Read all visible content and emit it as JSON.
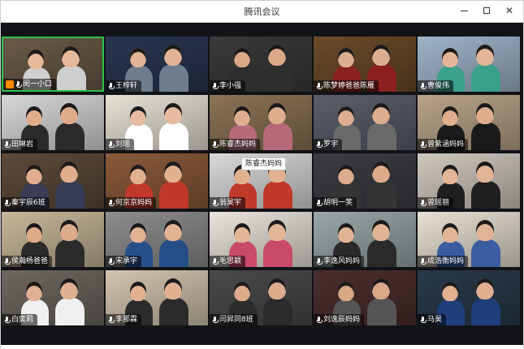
{
  "window": {
    "title": "腾讯会议",
    "controls": {
      "minimize_icon": "minimize-icon",
      "maximize_icon": "maximize-icon",
      "close_icon": "close-icon",
      "close_glyph": "✕"
    }
  },
  "tooltip": "陈睿杰妈妈",
  "participants": [
    {
      "name": "闵一小口",
      "host": true,
      "bg": "#6a5a48",
      "skin": "#e6b99a",
      "shirt": "#cfcfcf"
    },
    {
      "name": "王梓轩",
      "bg": "#2a3550",
      "skin": "#e2b394",
      "shirt": "#6f7d8e"
    },
    {
      "name": "李小强",
      "bg": "#3a3a3a",
      "skin": "#dba98a",
      "shirt": "#2e2e2e"
    },
    {
      "name": "陈梦婷爸爸陈雁",
      "bg": "#6a4a2a",
      "skin": "#dcae90",
      "shirt": "#8a2020"
    },
    {
      "name": "曹俊伟",
      "bg": "#9fb4c8",
      "skin": "#e2b596",
      "shirt": "#3aa08a"
    },
    {
      "name": "田琳岩",
      "bg": "#d8d8d8",
      "skin": "#e0ad8c",
      "shirt": "#2a2a2a"
    },
    {
      "name": "刘瑶",
      "bg": "#e7e2d6",
      "skin": "#e6bba0",
      "shirt": "#ffffff"
    },
    {
      "name": "陈睿杰妈妈",
      "bg": "#8b7355",
      "skin": "#deae8e",
      "shirt": "#b76a7a"
    },
    {
      "name": "罗宇",
      "bg": "#5a5f6a",
      "skin": "#dcae8f",
      "shirt": "#6a6a6a"
    },
    {
      "name": "曾紫涵妈妈",
      "bg": "#b9a48a",
      "skin": "#dfae8e",
      "shirt": "#1a1a1a"
    },
    {
      "name": "秦宇辰6班",
      "bg": "#5c4a3a",
      "skin": "#e0ae8f",
      "shirt": "#383c55"
    },
    {
      "name": "何京京妈妈",
      "bg": "#8a5a3a",
      "skin": "#e2b190",
      "shirt": "#c0392b"
    },
    {
      "name": "翁昊宇",
      "bg": "#d9d9d9",
      "skin": "#e1b292",
      "shirt": "#c0392b"
    },
    {
      "name": "胡明一笑",
      "bg": "#3b3d42",
      "skin": "#dcab8c",
      "shirt": "#353535"
    },
    {
      "name": "曾瑶丽",
      "bg": "#cfc8bf",
      "skin": "#e2b596",
      "shirt": "#1f1f1f"
    },
    {
      "name": "侯瀚杨爸爸",
      "bg": "#c7b79a",
      "skin": "#dcab8a",
      "shirt": "#2b2b2b"
    },
    {
      "name": "宋承宇",
      "bg": "#8d8d8d",
      "skin": "#e2b393",
      "shirt": "#264f8a"
    },
    {
      "name": "毛思颖",
      "bg": "#e9e4dc",
      "skin": "#e3b698",
      "shirt": "#c94a6a"
    },
    {
      "name": "李逸风妈妈",
      "bg": "#9aa6a6",
      "skin": "#e1b394",
      "shirt": "#2a2a2a"
    },
    {
      "name": "成浩衡妈妈",
      "bg": "#e7e0d4",
      "skin": "#e2b596",
      "shirt": "#3b5ca0"
    },
    {
      "name": "白奕莉",
      "bg": "#6d6760",
      "skin": "#dfb091",
      "shirt": "#efefef"
    },
    {
      "name": "李那霖",
      "bg": "#d3c5b0",
      "skin": "#e1b191",
      "shirt": "#2b2b2b"
    },
    {
      "name": "闫昇同8班",
      "bg": "#4a4a4a",
      "skin": "#dcab8c",
      "shirt": "#2b2b2b"
    },
    {
      "name": "刘逸辰妈妈",
      "bg": "#4b2e2e",
      "skin": "#d9a889",
      "shirt": "#555555"
    },
    {
      "name": "马昊",
      "bg": "#2a3a4a",
      "skin": "#e0b090",
      "shirt": "#1e3f7a"
    }
  ]
}
